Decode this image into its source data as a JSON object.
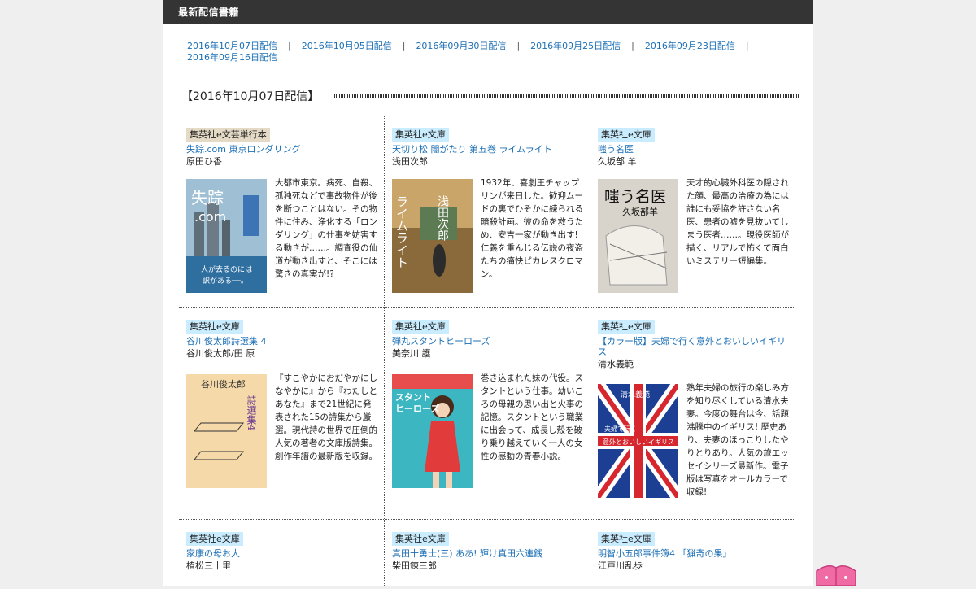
{
  "header": {
    "title": "最新配信書籍"
  },
  "date_nav": [
    "2016年10月07日配信",
    "2016年10月05日配信",
    "2016年09月30日配信",
    "2016年09月25日配信",
    "2016年09月23日配信",
    "2016年09月16日配信"
  ],
  "section": {
    "title": "【2016年10月07日配信】"
  },
  "books": [
    {
      "label": "集英社e文芸単行本",
      "title": "失踪.com 東京ロンダリング",
      "author": "原田ひ香",
      "desc": "大都市東京。病死、自殺、孤独死などで事故物件が後を断つことはない。その物件に住み、浄化する「ロンダリング」の仕事を妨害する動きが……。調査役の仙道が動き出すと、そこには驚きの真実が!?",
      "cover_text": [
        "失踪",
        ".com",
        "人が去るのには",
        "訳がある──。"
      ],
      "cover_color": "#2f6fa0"
    },
    {
      "label": "集英社e文庫",
      "title": "天切り松 闇がたり 第五巻 ライムライト",
      "author": "浅田次郎",
      "desc": "1932年、喜劇王チャップリンが来日した。歓迎ムードの裏でひそかに練られる暗殺計画。彼の命を救うため、安吉一家が動き出す! 仁義を重んじる伝説の夜盗たちの痛快ピカレスクロマン。",
      "cover_text": [
        "浅田次郎",
        "ライムライト"
      ],
      "cover_color": "#8a6a3a"
    },
    {
      "label": "集英社e文庫",
      "title": "嗤う名医",
      "author": "久坂部 羊",
      "desc": "天才的心臓外科医の隠された顔、最高の治療の為には誰にも妥協を許さない名医、患者の嘘を見抜いてしまう医者……。現役医師が描く、リアルで怖くて面白いミステリー短編集。",
      "cover_text": [
        "嗤う名医",
        "久坂部羊"
      ],
      "cover_color": "#d8d4cc"
    },
    {
      "label": "集英社e文庫",
      "title": "谷川俊太郎詩選集 4",
      "author": "谷川俊太郎/田 原",
      "desc": "『すこやかにおだやかにしなやかに』から『わたしとあなた』まで21世紀に発表された15の詩集から厳選。現代詩の世界で圧倒的人気の著者の文庫版詩集。創作年譜の最新版を収録。",
      "cover_text": [
        "谷川俊太郎",
        "詩選集4"
      ],
      "cover_color": "#f6d9a8"
    },
    {
      "label": "集英社e文庫",
      "title": "弾丸スタントヒーローズ",
      "author": "美奈川 護",
      "desc": "巻き込まれた妹の代役。スタントという仕事。幼いころの母親の思い出と火事の記憶。スタントという職業に出会って、成長し殻を破り乗り越えていく一人の女性の感動の青春小説。",
      "cover_text": [
        "スタント",
        "ヒーローズ"
      ],
      "cover_color": "#3cb7c2"
    },
    {
      "label": "集英社e文庫",
      "title": "【カラー版】夫婦で行く意外とおいしいイギリス",
      "author": "清水義範",
      "desc": "熟年夫婦の旅行の楽しみ方を知り尽くしている清水夫妻。今度の舞台は今、話題沸騰中のイギリス! 歴史あり、夫妻のほっこりしたやりとりあり。人気の旅エッセイシリーズ最新作。電子版は写真をオールカラーで収録!",
      "cover_text": [
        "清水義範",
        "夫婦で行く",
        "意外とおいしいイギリス"
      ],
      "cover_color": "#1c3f93"
    },
    {
      "label": "集英社e文庫",
      "title": "家康の母お大",
      "author": "植松三十里"
    },
    {
      "label": "集英社e文庫",
      "title": "真田十勇士(三) ああ! 輝け真田六連銭",
      "author": "柴田錬三郎"
    },
    {
      "label": "集英社e文庫",
      "title": "明智小五郎事件簿4 「猟奇の果」",
      "author": "江戸川乱歩"
    }
  ]
}
